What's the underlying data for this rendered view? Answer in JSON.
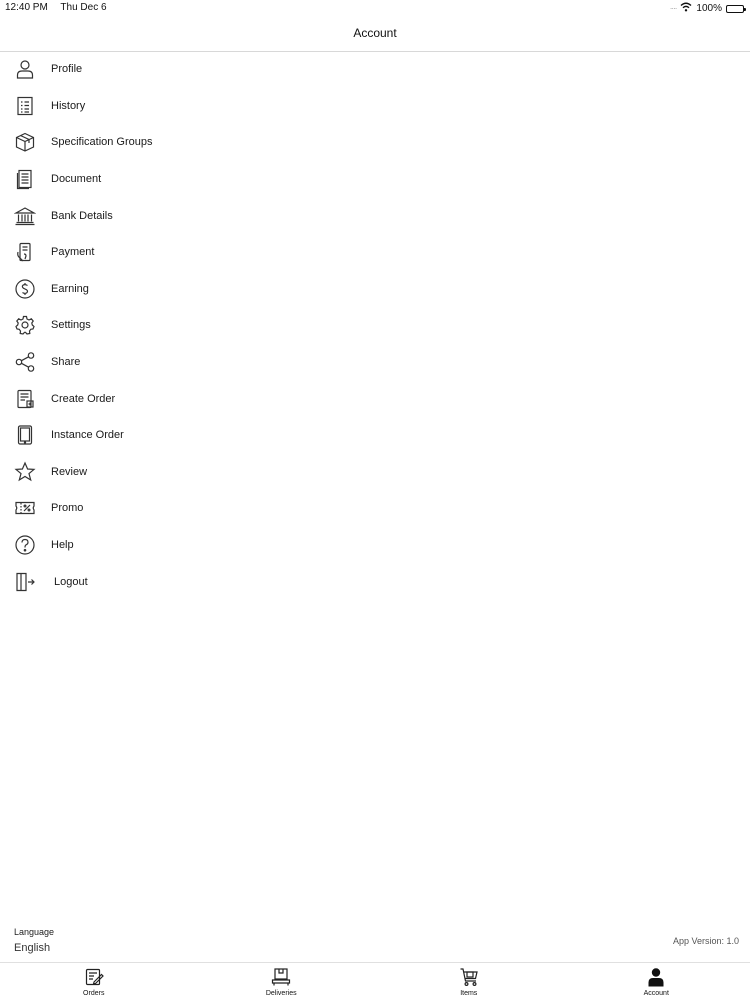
{
  "status_bar": {
    "time": "12:40 PM",
    "date": "Thu Dec 6",
    "battery": "100%"
  },
  "navbar": {
    "title": "Account"
  },
  "menu": [
    {
      "label": "Profile",
      "icon": "user-icon"
    },
    {
      "label": "History",
      "icon": "list-icon"
    },
    {
      "label": "Specification Groups",
      "icon": "box-icon"
    },
    {
      "label": "Document",
      "icon": "document-icon"
    },
    {
      "label": "Bank Details",
      "icon": "bank-icon"
    },
    {
      "label": "Payment",
      "icon": "payment-icon"
    },
    {
      "label": "Earning",
      "icon": "dollar-icon"
    },
    {
      "label": "Settings",
      "icon": "gear-icon"
    },
    {
      "label": "Share",
      "icon": "share-icon"
    },
    {
      "label": "Create Order",
      "icon": "create-order-icon"
    },
    {
      "label": "Instance Order",
      "icon": "tablet-icon"
    },
    {
      "label": "Review",
      "icon": "star-icon"
    },
    {
      "label": "Promo",
      "icon": "promo-icon"
    },
    {
      "label": "Help",
      "icon": "help-icon"
    },
    {
      "label": "Logout",
      "icon": "logout-icon"
    }
  ],
  "footer": {
    "language_label": "Language",
    "language_value": "English",
    "app_version": "App Version: 1.0"
  },
  "tabs": [
    {
      "label": "Orders",
      "icon": "orders-icon",
      "active": false
    },
    {
      "label": "Deliveries",
      "icon": "deliveries-icon",
      "active": false
    },
    {
      "label": "Items",
      "icon": "cart-icon",
      "active": false
    },
    {
      "label": "Account",
      "icon": "account-icon",
      "active": true
    }
  ]
}
